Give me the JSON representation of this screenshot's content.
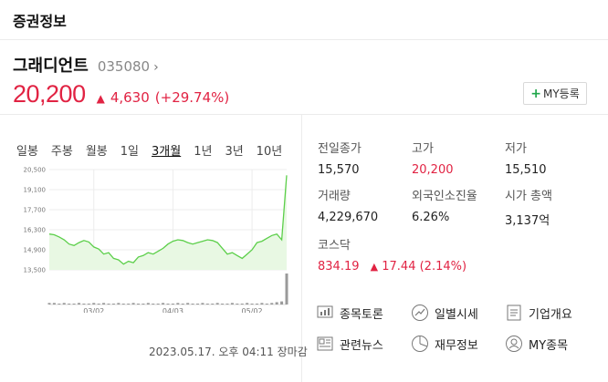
{
  "header": {
    "title": "증권정보"
  },
  "stock": {
    "name": "그래디언트",
    "code": "035080",
    "price": "20,200",
    "change": "4,630",
    "change_pct": "(+29.74%)",
    "up_color": "#e12343"
  },
  "my_button": {
    "label": "MY등록"
  },
  "tabs": [
    "일봉",
    "주봉",
    "월봉",
    "1일",
    "3개월",
    "1년",
    "3년",
    "10년"
  ],
  "active_tab": "3개월",
  "chart_data": {
    "type": "area",
    "ylabels": [
      "20,500",
      "19,100",
      "17,700",
      "16,300",
      "14,900",
      "13,500"
    ],
    "ylim": [
      13500,
      20500
    ],
    "xlabels": [
      "03/02",
      "04/03",
      "05/02"
    ],
    "values": [
      16000,
      15950,
      15800,
      15600,
      15300,
      15200,
      15400,
      15550,
      15450,
      15100,
      14950,
      14600,
      14700,
      14300,
      14200,
      13900,
      14100,
      14000,
      14400,
      14500,
      14700,
      14600,
      14800,
      15000,
      15300,
      15500,
      15600,
      15550,
      15400,
      15300,
      15400,
      15500,
      15600,
      15550,
      15400,
      15000,
      14600,
      14700,
      14500,
      14300,
      14600,
      14900,
      15400,
      15500,
      15700,
      15900,
      16000,
      15600,
      20100
    ],
    "volumes": [
      2,
      2,
      1,
      2,
      1,
      1,
      2,
      1,
      1,
      2,
      1,
      2,
      1,
      1,
      2,
      1,
      1,
      2,
      1,
      1,
      2,
      1,
      1,
      2,
      1,
      1,
      2,
      1,
      2,
      1,
      1,
      2,
      1,
      1,
      2,
      1,
      1,
      2,
      1,
      1,
      2,
      1,
      1,
      2,
      1,
      2,
      3,
      4,
      40
    ],
    "grid": true
  },
  "timestamp": "2023.05.17. 오후 04:11 장마감",
  "stats": [
    {
      "label": "전일종가",
      "value": "15,570",
      "red": false
    },
    {
      "label": "고가",
      "value": "20,200",
      "red": true
    },
    {
      "label": "저가",
      "value": "15,510",
      "red": false
    },
    {
      "label": "거래량",
      "value": "4,229,670",
      "red": false
    },
    {
      "label": "외국인소진율",
      "value": "6.26%",
      "red": false
    },
    {
      "label": "시가 총액",
      "value": "3,137억",
      "red": false
    }
  ],
  "kospi": {
    "label": "코스닥",
    "value": "834.19",
    "change": "17.44",
    "pct": "(2.14%)"
  },
  "links": [
    {
      "label": "종목토론",
      "icon": "discussion-icon"
    },
    {
      "label": "일별시세",
      "icon": "daily-chart-icon"
    },
    {
      "label": "기업개요",
      "icon": "company-overview-icon"
    },
    {
      "label": "관련뉴스",
      "icon": "news-icon"
    },
    {
      "label": "재무정보",
      "icon": "financial-pie-icon"
    },
    {
      "label": "MY종목",
      "icon": "my-stocks-icon"
    }
  ]
}
